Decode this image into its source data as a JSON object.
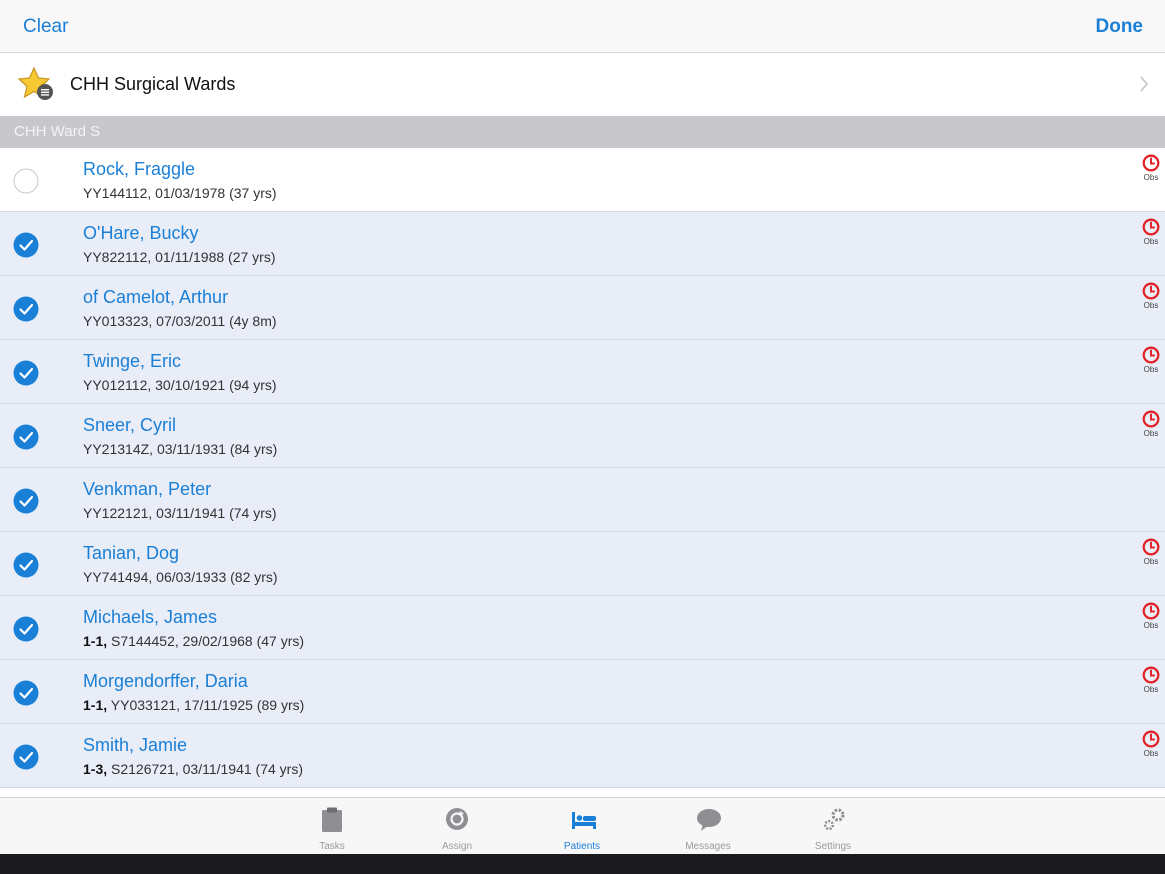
{
  "topbar": {
    "clear_label": "Clear",
    "done_label": "Done"
  },
  "ward": {
    "label": "CHH Surgical Wards"
  },
  "section": {
    "title": "CHH Ward S"
  },
  "patients": [
    {
      "name": "Rock, Fraggle",
      "prefix": "",
      "details": "YY144112, 01/03/1978 (37 yrs)",
      "selected": false,
      "obs": true,
      "obs_label": "Obs"
    },
    {
      "name": "O'Hare, Bucky",
      "prefix": "",
      "details": "YY822112, 01/11/1988 (27 yrs)",
      "selected": true,
      "obs": true,
      "obs_label": "Obs"
    },
    {
      "name": "of Camelot, Arthur",
      "prefix": "",
      "details": "YY013323, 07/03/2011 (4y 8m)",
      "selected": true,
      "obs": true,
      "obs_label": "Obs"
    },
    {
      "name": "Twinge, Eric",
      "prefix": "",
      "details": "YY012112, 30/10/1921 (94 yrs)",
      "selected": true,
      "obs": true,
      "obs_label": "Obs"
    },
    {
      "name": "Sneer, Cyril",
      "prefix": "",
      "details": "YY21314Z, 03/11/1931 (84 yrs)",
      "selected": true,
      "obs": true,
      "obs_label": "Obs"
    },
    {
      "name": "Venkman, Peter",
      "prefix": "",
      "details": "YY122121, 03/11/1941 (74 yrs)",
      "selected": true,
      "obs": false,
      "obs_label": ""
    },
    {
      "name": "Tanian, Dog",
      "prefix": "",
      "details": "YY741494, 06/03/1933 (82 yrs)",
      "selected": true,
      "obs": true,
      "obs_label": "Obs"
    },
    {
      "name": "Michaels, James",
      "prefix": "1-1,",
      "details": "S7144452, 29/02/1968 (47 yrs)",
      "selected": true,
      "obs": true,
      "obs_label": "Obs"
    },
    {
      "name": "Morgendorffer, Daria",
      "prefix": "1-1,",
      "details": "YY033121, 17/11/1925 (89 yrs)",
      "selected": true,
      "obs": true,
      "obs_label": "Obs"
    },
    {
      "name": "Smith, Jamie",
      "prefix": "1-3,",
      "details": "S2126721, 03/11/1941 (74 yrs)",
      "selected": true,
      "obs": true,
      "obs_label": "Obs"
    }
  ],
  "tabs": [
    {
      "label": "Tasks",
      "icon": "clipboard-icon",
      "active": false
    },
    {
      "label": "Assign",
      "icon": "assign-icon",
      "active": false
    },
    {
      "label": "Patients",
      "icon": "bed-icon",
      "active": true
    },
    {
      "label": "Messages",
      "icon": "speech-bubble-icon",
      "active": false
    },
    {
      "label": "Settings",
      "icon": "gear-icon",
      "active": false
    }
  ],
  "colors": {
    "accent": "#1a7fd6",
    "obs_alert": "#e2232a",
    "selected_row": "#e8edf7",
    "section_header": "#c8c8cc"
  }
}
